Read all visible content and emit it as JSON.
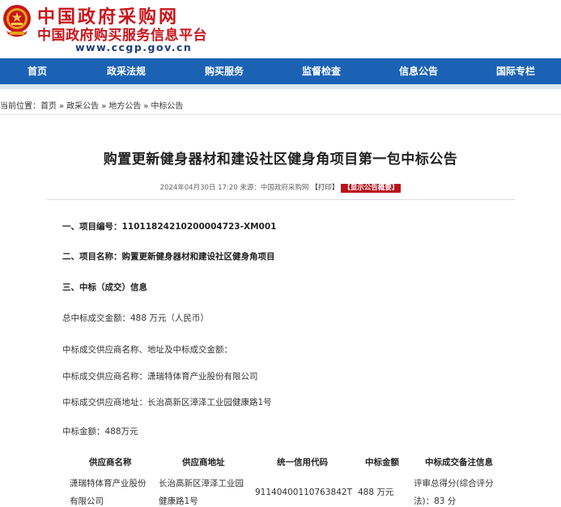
{
  "header": {
    "site_title": "中国政府采购网",
    "site_subtitle": "中国政府购买服务信息平台",
    "site_url": "www.ccgp.gov.cn"
  },
  "nav": {
    "items": [
      {
        "label": "首页"
      },
      {
        "label": "政采法规"
      },
      {
        "label": "购买服务"
      },
      {
        "label": "监督检查"
      },
      {
        "label": "信息公告"
      },
      {
        "label": "国际专栏"
      }
    ]
  },
  "breadcrumb": {
    "prefix": "当前位置：",
    "items": [
      "首页",
      "政采公告",
      "地方公告",
      "中标公告"
    ],
    "separator": "»"
  },
  "article": {
    "title": "购置更新健身器材和建设社区健身角项目第一包中标公告",
    "meta": {
      "datetime": "2024年04月30日 17:20",
      "source": "来源：中国政府采购网",
      "print": "【打印】",
      "summary_button": "【显示公告概要】"
    },
    "sections": {
      "s1": "一、项目编号：11011824210200004723-XM001",
      "s2": "二、项目名称：购置更新健身器材和建设社区健身角项目",
      "s3": "三、中标（成交）信息"
    },
    "paragraphs": {
      "total": "总中标成交金额：488 万元（人民币）",
      "intro": "中标成交供应商名称、地址及中标成交金额：",
      "supplier_name": "中标成交供应商名称：潇瑞特体育产业股份有限公司",
      "supplier_addr": "中标成交供应商地址：长治高新区漳泽工业园健康路1号",
      "amount": "中标金额：488万元"
    },
    "table": {
      "headers": [
        "供应商名称",
        "供应商地址",
        "统一信用代码",
        "中标金额",
        "中标成交备注信息"
      ],
      "row": {
        "name_line1": "潇瑞特体育产业股份",
        "name_line2": "有限公司",
        "addr_line1": "长治高新区漳泽工业园",
        "addr_line2": "健康路1号",
        "credit_code": "91140400110763842T",
        "amount": "488 万元",
        "note_line1": "评审总得分(综合评分",
        "note_line2": "法)：83 分"
      }
    }
  },
  "colors": {
    "brand_red": "#c8151b",
    "nav_blue": "#1b62b5",
    "url_navy": "#1d3d7a"
  }
}
